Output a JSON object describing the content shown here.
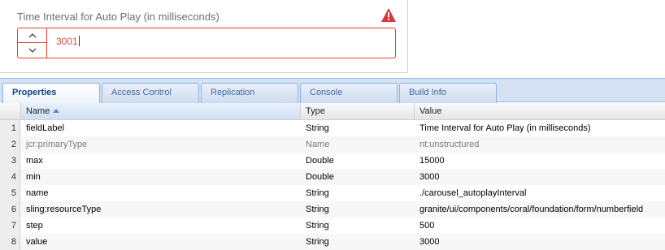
{
  "field": {
    "label": "Time Interval for Auto Play (in milliseconds)",
    "value": "3001",
    "warning_icon": "alert-triangle-icon",
    "error_color": "#e14132"
  },
  "tabs": [
    {
      "label": "Properties",
      "active": true
    },
    {
      "label": "Access Control",
      "active": false
    },
    {
      "label": "Replication",
      "active": false
    },
    {
      "label": "Console",
      "active": false
    },
    {
      "label": "Build Info",
      "active": false
    }
  ],
  "grid": {
    "columns": [
      "Name",
      "Type",
      "Value"
    ],
    "sort_column": "Name",
    "sort_direction": "ascending",
    "rows": [
      {
        "num": "1",
        "name": "fieldLabel",
        "type": "String",
        "value": "Time Interval for Auto Play (in milliseconds)"
      },
      {
        "num": "2",
        "name": "jcr:primaryType",
        "type": "Name",
        "value": "nt:unstructured"
      },
      {
        "num": "3",
        "name": "max",
        "type": "Double",
        "value": "15000"
      },
      {
        "num": "4",
        "name": "min",
        "type": "Double",
        "value": "3000"
      },
      {
        "num": "5",
        "name": "name",
        "type": "String",
        "value": "./carousel_autoplayInterval"
      },
      {
        "num": "6",
        "name": "sling:resourceType",
        "type": "String",
        "value": "granite/ui/components/coral/foundation/form/numberfield"
      },
      {
        "num": "7",
        "name": "step",
        "type": "String",
        "value": "500"
      },
      {
        "num": "8",
        "name": "value",
        "type": "String",
        "value": "3000"
      }
    ]
  }
}
